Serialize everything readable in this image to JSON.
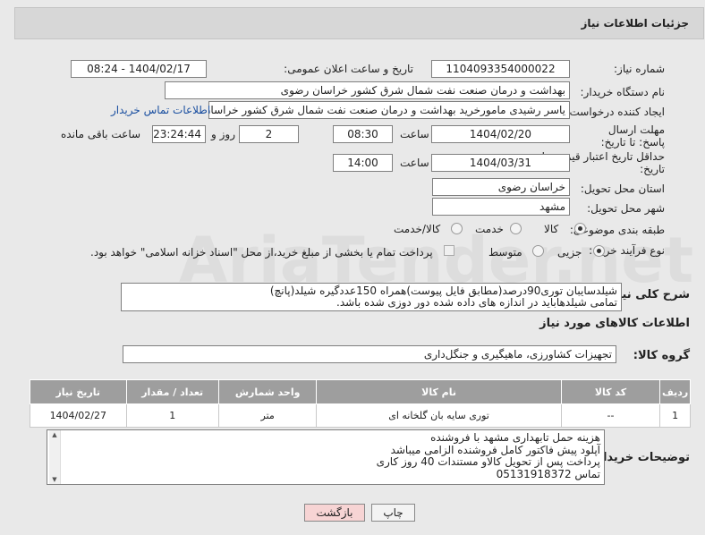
{
  "header": {
    "title": "جزئیات اطلاعات نیاز"
  },
  "fields": {
    "need_number_label": "شماره نیاز:",
    "need_number": "1104093354000022",
    "announce_label": "تاریخ و ساعت اعلان عمومی:",
    "announce_value": "1404/02/17 - 08:24",
    "buyer_org_label": "نام دستگاه خریدار:",
    "buyer_org": "بهداشت و درمان صنعت نفت شمال شرق کشور   خراسان رضوی",
    "creator_label": "ایجاد کننده درخواست:",
    "creator": "یاسر رشیدی مامورخرید بهداشت و درمان صنعت نفت شمال شرق کشور   خراسان",
    "contact_link": "اطلاعات تماس خریدار",
    "reply_deadline_label": "مهلت ارسال پاسخ: تا تاریخ:",
    "reply_date": "1404/02/20",
    "hour_label": "ساعت",
    "reply_time": "08:30",
    "days": "2",
    "days_label": "روز و",
    "remaining": "23:24:44",
    "remaining_label": "ساعت باقی مانده",
    "price_validity_label": "حداقل تاریخ اعتبار قیمت: تا تاریخ:",
    "price_date": "1404/03/31",
    "price_time": "14:00",
    "province_label": "استان محل تحویل:",
    "province": "خراسان رضوی",
    "city_label": "شهر محل تحویل:",
    "city": "مشهد",
    "category_label": "طبقه بندی موضوعی:",
    "category_options": [
      "کالا",
      "خدمت",
      "کالا/خدمت"
    ],
    "process_label": "نوع فرآیند خرید :",
    "process_options": [
      "جزیی",
      "متوسط"
    ],
    "payment_note": "پرداخت تمام یا بخشی از مبلغ خرید،از محل \"اسناد خزانه اسلامی\" خواهد بود."
  },
  "description": {
    "label": "شرح کلی نیاز:",
    "line1": "شیلدسایبان توری90درصد(مطابق فایل پیوست)همراه 150عددگیره شیلد(پانچ)",
    "line2": "تمامی شیلدهاباید در اندازه های داده شده دور دوزی شده باشد."
  },
  "goods": {
    "section_title": "اطلاعات کالاهای مورد نیاز",
    "group_label": "گروه کالا:",
    "group_value": "تجهیزات کشاورزی، ماهیگیری و جنگل‌داری",
    "columns": [
      "ردیف",
      "کد کالا",
      "نام کالا",
      "واحد شمارش",
      "تعداد / مقدار",
      "تاریخ نیاز"
    ],
    "rows": [
      {
        "row": "1",
        "code": "--",
        "name": "توری سایه بان گلخانه ای",
        "unit": "متر",
        "qty": "1",
        "date": "1404/02/27"
      }
    ]
  },
  "buyer_notes": {
    "label": "توضیحات خریدار:",
    "lines": [
      "هزینه حمل تابهداری مشهد با فروشنده",
      "آپلود پیش فاکتور کامل فروشنده الزامی میباشد",
      "پرداخت پس از تحویل کالاو مستندات 40 روز کاری",
      "تماس 05131918372"
    ]
  },
  "buttons": {
    "print": "چاپ",
    "back": "بازگشت"
  },
  "colors": {
    "back_button_bg": "#f7d4d4",
    "link": "#1a4fa0"
  }
}
